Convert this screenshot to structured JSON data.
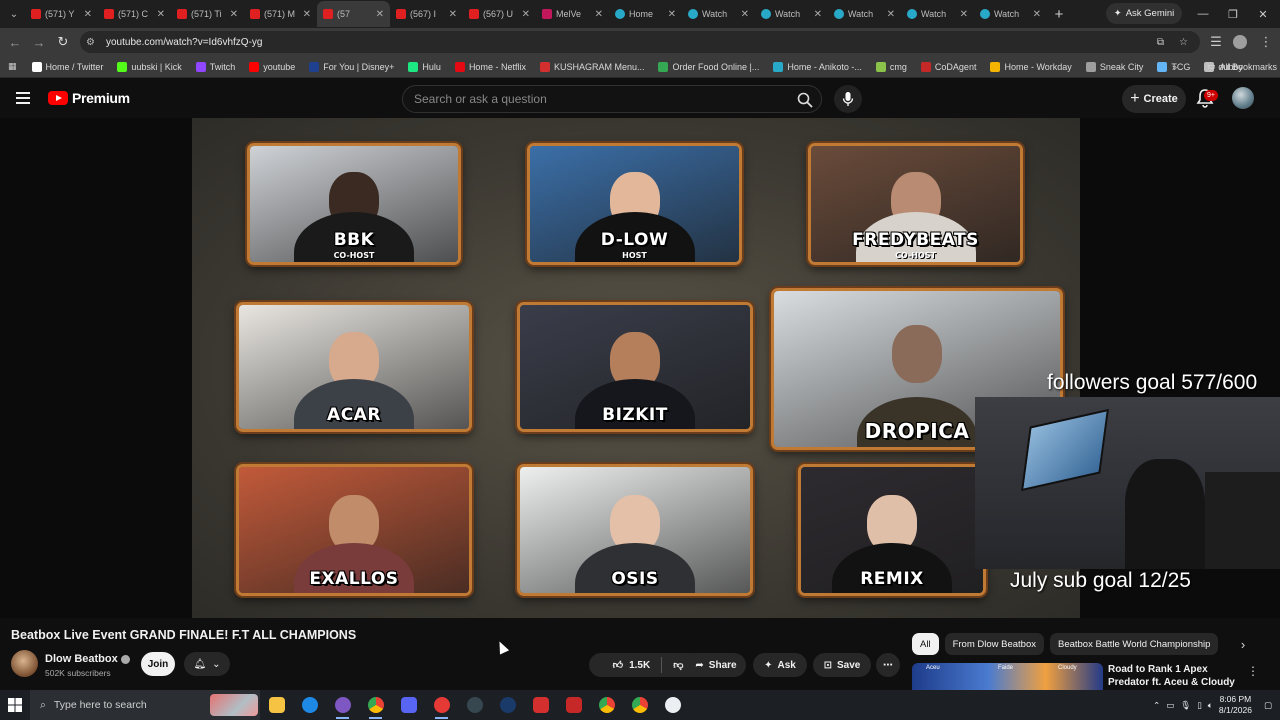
{
  "browser": {
    "tabs": [
      {
        "label": "(571) Y",
        "favicon": "yt"
      },
      {
        "label": "(571) C",
        "favicon": "yt"
      },
      {
        "label": "(571) Ti",
        "favicon": "yt"
      },
      {
        "label": "(571) M",
        "favicon": "yt"
      },
      {
        "label": "(57",
        "favicon": "yt",
        "active": true
      },
      {
        "label": "(567) I",
        "favicon": "yt"
      },
      {
        "label": "(567) U",
        "favicon": "yt"
      },
      {
        "label": "MelVe",
        "favicon": "mv"
      },
      {
        "label": "Home",
        "favicon": "gl"
      },
      {
        "label": "Watch",
        "favicon": "gl"
      },
      {
        "label": "Watch",
        "favicon": "gl"
      },
      {
        "label": "Watch",
        "favicon": "gl"
      },
      {
        "label": "Watch",
        "favicon": "gl"
      },
      {
        "label": "Watch",
        "favicon": "gl"
      }
    ],
    "ask_gemini": "Ask Gemini",
    "url": "youtube.com/watch?v=Id6vhfzQ-yg",
    "bookmarks": [
      {
        "label": "Home / Twitter",
        "color": "#ffffff"
      },
      {
        "label": "uubski | Kick",
        "color": "#53fc18"
      },
      {
        "label": "Twitch",
        "color": "#9146ff"
      },
      {
        "label": "youtube",
        "color": "#ff0000"
      },
      {
        "label": "For You | Disney+",
        "color": "#1f3f8f"
      },
      {
        "label": "Hulu",
        "color": "#1ce783"
      },
      {
        "label": "Home - Netflix",
        "color": "#e50914"
      },
      {
        "label": "KUSHAGRAM Menu...",
        "color": "#d32f2f"
      },
      {
        "label": "Order Food Online |...",
        "color": "#34a853"
      },
      {
        "label": "Home - Anikoto -...",
        "color": "#29a9c8"
      },
      {
        "label": "cmg",
        "color": "#8bc34a"
      },
      {
        "label": "CoDAgent",
        "color": "#c62828"
      },
      {
        "label": "Home - Workday",
        "color": "#f4b400"
      },
      {
        "label": "Sneak City",
        "color": "#9e9e9e"
      },
      {
        "label": "TCG",
        "color": "#64b5f6"
      },
      {
        "label": "dubby",
        "color": "#bdbdbd"
      }
    ],
    "all_bookmarks": "All Bookmarks"
  },
  "youtube": {
    "logo_text": "Premium",
    "search_placeholder": "Search or ask a question",
    "create_label": "Create",
    "notification_count": "9+"
  },
  "video": {
    "participants": [
      {
        "name": "BBK",
        "role": "CO-HOST"
      },
      {
        "name": "D-LOW",
        "role": "HOST"
      },
      {
        "name": "FREDYBEATS",
        "role": "CO-HOST"
      },
      {
        "name": "ACAR",
        "role": ""
      },
      {
        "name": "BIZKIT",
        "role": ""
      },
      {
        "name": "DROPICA",
        "role": ""
      },
      {
        "name": "EXALLOS",
        "role": ""
      },
      {
        "name": "OSIS",
        "role": ""
      },
      {
        "name": "REMIX",
        "role": ""
      }
    ],
    "overlay_followers": "followers goal 577/600",
    "overlay_subs": "July sub goal 12/25"
  },
  "details": {
    "title": "Beatbox Live Event GRAND FINALE! F.T ALL CHAMPIONS",
    "channel_name": "Dlow Beatbox",
    "subscribers": "502K subscribers",
    "join_label": "Join",
    "likes": "1.5K",
    "share_label": "Share",
    "ask_label": "Ask",
    "save_label": "Save"
  },
  "sidebar": {
    "chips": [
      "All",
      "From Dlow Beatbox",
      "Beatbox Battle World Championship"
    ],
    "rec_title": "Road to Rank 1 Apex Predator ft. Aceu & Cloudy",
    "rec_thumb_labels": [
      "Aceu",
      "Faide",
      "Cloudy"
    ]
  },
  "taskbar": {
    "search_placeholder": "Type here to search",
    "time": "8:06 PM",
    "date": "8/1/2026"
  }
}
